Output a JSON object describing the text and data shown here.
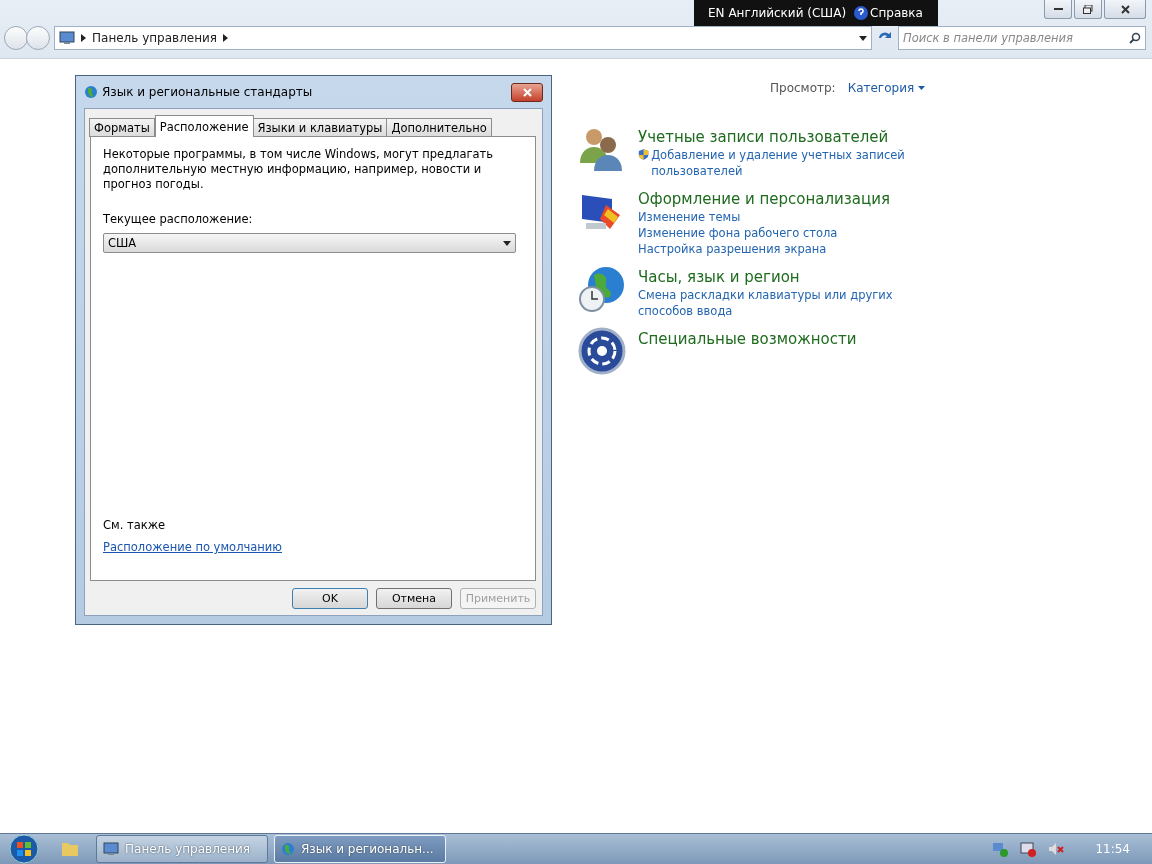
{
  "language_bar": {
    "language_code": "EN",
    "language_name": "Английский (США)",
    "help": "Справка"
  },
  "address_bar": {
    "path": "Панель управления",
    "search": {
      "placeholder": "Поиск в панели управления"
    }
  },
  "view": {
    "label": "Просмотр:",
    "value": "Категория"
  },
  "categories": [
    {
      "title": "Учетные записи пользователей",
      "links": [
        {
          "text": "Добавление и удаление учетных записей пользователей",
          "shield": true
        }
      ]
    },
    {
      "title": "Оформление и персонализация",
      "links": [
        {
          "text": "Изменение темы",
          "shield": false
        },
        {
          "text": "Изменение фона рабочего стола",
          "shield": false
        },
        {
          "text": "Настройка разрешения экрана",
          "shield": false
        }
      ]
    },
    {
      "title": "Часы, язык и регион",
      "links": [
        {
          "text": "Смена раскладки клавиатуры или других способов ввода",
          "shield": false
        }
      ]
    },
    {
      "title": "Специальные возможности"
    }
  ],
  "dialog": {
    "title": "Язык и региональные стандарты",
    "tabs": [
      {
        "label": "Форматы",
        "selected": false
      },
      {
        "label": "Расположение",
        "selected": true
      },
      {
        "label": "Языки и клавиатуры",
        "selected": false
      },
      {
        "label": "Дополнительно",
        "selected": false
      }
    ],
    "description": "Некоторые программы, в том числе Windows, могут предлагать дополнительную местную информацию, например, новости и прогноз погоды.",
    "location_label": "Текущее расположение:",
    "location_value": "США",
    "see_also": "См. также",
    "see_also_link": "Расположение по умолчанию",
    "buttons": [
      {
        "label": "OK",
        "default": true,
        "disabled": false
      },
      {
        "label": "Отмена",
        "default": false,
        "disabled": false
      },
      {
        "label": "Применить",
        "default": false,
        "disabled": true
      }
    ]
  },
  "taskbar": {
    "items": [
      {
        "label": "Панель управления",
        "selected": false
      },
      {
        "label": "Язык и региональн...",
        "selected": true
      }
    ],
    "clock": "11:54"
  }
}
